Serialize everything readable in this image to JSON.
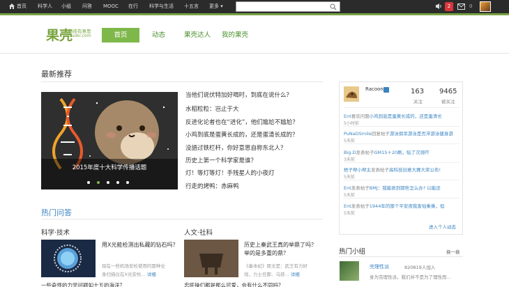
{
  "topbar": {
    "nav": [
      "首页",
      "科学人",
      "小组",
      "问答",
      "MOOC",
      "在行",
      "科学与生活",
      "十五言",
      "更多 ▾"
    ],
    "notification_count": "2",
    "mail_count": "0"
  },
  "header": {
    "logo_text": "果壳",
    "logo_slogan": "科技有意思",
    "logo_url": "Guokr.com",
    "nav": [
      "首页",
      "动态",
      "果壳达人",
      "我的果壳"
    ]
  },
  "recommend": {
    "title": "最新推荐",
    "hero_caption": "2015年度十大科学传播话题",
    "links": [
      "当他们说伏特加好喝时，到底在说什么？",
      "水稻粒粒：岂止于大",
      "反进化论者也在“进化”，他们尴尬不尴尬？",
      "小鸡到底是蛋黄长成的，还是蛋清长成的？",
      "没語过铁栏杆，你好意思自称东北人？",
      "历史上第一个科学家是谁？",
      "灯！等灯等灯！手残星人的小夜灯",
      "行走的烤鸭：赤麻鸭"
    ]
  },
  "hot_qa": {
    "title": "热门问答",
    "columns": [
      {
        "label": "科学·技术",
        "question": "用X光能检测出私藏的钻石吗？",
        "desc_line1": "现在一些机场安检使用的那种全",
        "desc_line2": "身扫描仪在X光安检...",
        "desc_link": "详细",
        "bottom": "一些奇怪的力学问题如十五的海洋？"
      },
      {
        "label": "人文·社科",
        "question": "历史上秦武王真的举鼎了吗？举的是多重的鼎？",
        "desc_line1": "《秦本纪》原文是：武王有力好",
        "desc_line2": "戏，力士任鄙、乌获...",
        "desc_link": "详细",
        "bottom": "忠肝操们都是那么可爱，会有什么不同吗？"
      }
    ]
  },
  "user_card": {
    "name": "Racoon",
    "stats": [
      {
        "value": "163",
        "label": "关注"
      },
      {
        "value": "9465",
        "label": "被关注"
      }
    ],
    "feed": [
      {
        "user": "Ent",
        "action": "喜欢问题",
        "target": "小鸡到底是蛋黄长成的，还是蛋清长",
        "time": "5小时前"
      },
      {
        "user": "PuNaDSmile",
        "action": "回复帖子",
        "target": "游泳倒吊游泳是否浮游泳健身游",
        "time": "5天前"
      },
      {
        "user": "Big.D",
        "action": "发表帖子",
        "target": "GM1S＋20刷，贴了次烧吓",
        "time": "3天前"
      },
      {
        "user": "梧子帮小帮主",
        "action": "发表帖子",
        "target": "高科技创意大赛大奖公布!",
        "time": "5天前"
      },
      {
        "user": "Ent",
        "action": "发表帖子",
        "target": "BMJ：我能收到那些怎么办? 以能还",
        "time": "5天前"
      },
      {
        "user": "Ent",
        "action": "发表帖子",
        "target": "1944年的那个平安夜我害怕乘乘，但",
        "time": "5天前"
      }
    ],
    "more": "进入个人动态"
  },
  "hot_groups": {
    "title": "热门小组",
    "refresh": "换一换",
    "group_name": "完理性派",
    "group_count": "820819人加入",
    "group_desc": "身为完理性派，我们并不是为了理性而..."
  }
}
